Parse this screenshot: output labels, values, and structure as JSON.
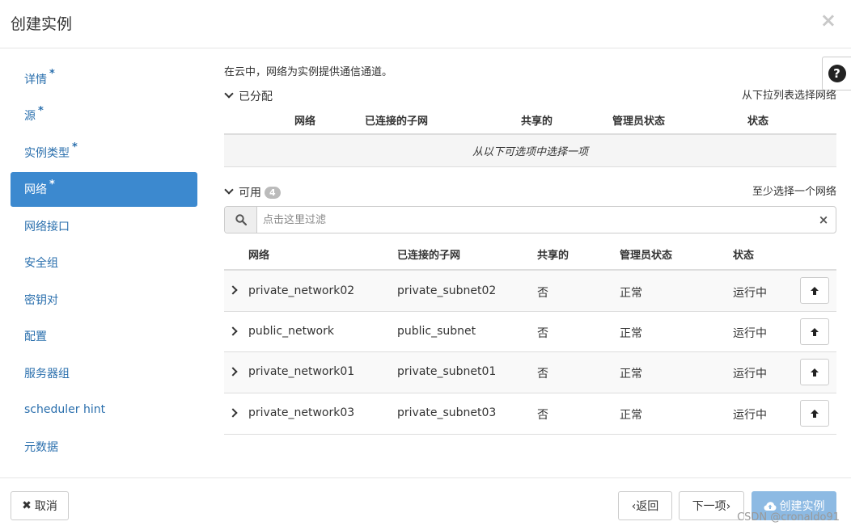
{
  "modal": {
    "title": "创建实例",
    "close_label": "×"
  },
  "sidebar": {
    "items": [
      {
        "label": "详情",
        "required": "*"
      },
      {
        "label": "源",
        "required": "*"
      },
      {
        "label": "实例类型",
        "required": "*"
      },
      {
        "label": "网络",
        "required": "*",
        "active": true
      },
      {
        "label": "网络接口"
      },
      {
        "label": "安全组"
      },
      {
        "label": "密钥对"
      },
      {
        "label": "配置"
      },
      {
        "label": "服务器组"
      },
      {
        "label": "scheduler hint"
      },
      {
        "label": "元数据"
      }
    ]
  },
  "main": {
    "description": "在云中，网络为实例提供通信通道。",
    "help_label": "?",
    "allocated": {
      "title": "已分配",
      "note": "从下拉列表选择网络",
      "columns": [
        "网络",
        "已连接的子网",
        "共享的",
        "管理员状态",
        "状态"
      ],
      "empty_text": "从以下可选项中选择一项"
    },
    "available": {
      "title": "可用",
      "count": "4",
      "note": "至少选择一个网络",
      "filter_placeholder": "点击这里过滤",
      "clear_label": "×",
      "columns": [
        "网络",
        "已连接的子网",
        "共享的",
        "管理员状态",
        "状态"
      ],
      "rows": [
        {
          "network": "private_network02",
          "subnet": "private_subnet02",
          "shared": "否",
          "admin_state": "正常",
          "status": "运行中"
        },
        {
          "network": "public_network",
          "subnet": "public_subnet",
          "shared": "否",
          "admin_state": "正常",
          "status": "运行中"
        },
        {
          "network": "private_network01",
          "subnet": "private_subnet01",
          "shared": "否",
          "admin_state": "正常",
          "status": "运行中"
        },
        {
          "network": "private_network03",
          "subnet": "private_subnet03",
          "shared": "否",
          "admin_state": "正常",
          "status": "运行中"
        }
      ]
    }
  },
  "footer": {
    "cancel_label": "取消",
    "back_label": "‹返回",
    "next_label": "下一项›",
    "create_label": "创建实例",
    "watermark": "CSDN @cronaldo91"
  },
  "colors": {
    "accent": "#3c89cf",
    "link": "#2a6fad",
    "primary_disabled": "#8dbae3"
  }
}
